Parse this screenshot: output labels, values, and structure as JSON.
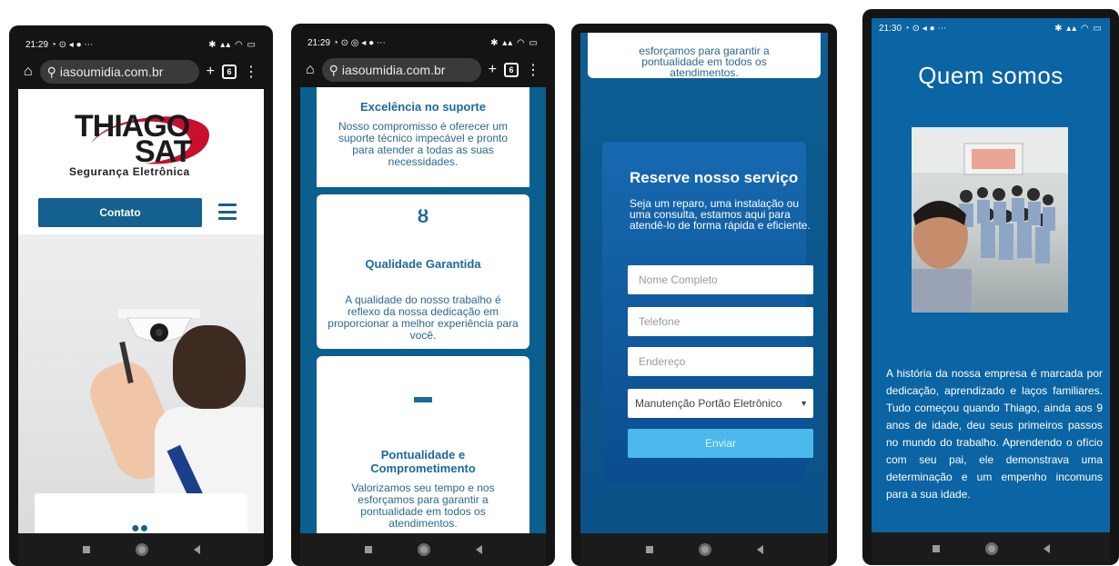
{
  "browser": {
    "url": "iasoumidia.com.br",
    "tab_count": "6"
  },
  "phones": [
    {
      "time": "21:29",
      "logo_line1": "THIAGO",
      "logo_line2": "SAT",
      "logo_sub": "Segurança Eletrônica",
      "contact_button": "Contato"
    },
    {
      "time": "21:29",
      "cards": [
        {
          "title": "Excelência no suporte",
          "text": "Nosso compromisso é oferecer um suporte técnico impecável e pronto para atender a todas as suas necessidades."
        },
        {
          "title": "Qualidade Garantida",
          "text": "A qualidade do nosso trabalho é reflexo da nossa dedicação em proporcionar a melhor experiência para você."
        },
        {
          "title": "Pontualidade e Comprometimento",
          "text": "Valorizamos seu tempo e nos esforçamos para garantir a pontualidade em todos os atendimentos."
        }
      ]
    },
    {
      "time": "21:29",
      "top_card_text": "esforçamos para garantir a pontualidade em todos os atendimentos.",
      "form_title": "Reserve nosso serviço",
      "form_desc": "Seja um reparo, uma instalação ou uma consulta, estamos aqui para atendê-lo de forma rápida e eficiente.",
      "placeholder_name": "Nome Completo",
      "placeholder_phone": "Telefone",
      "placeholder_address": "Endereço",
      "select_value": "Manutenção Portão Eletrônico",
      "submit_label": "Enviar"
    },
    {
      "time": "21:30",
      "title": "Quem somos",
      "paragraph": "A história da nossa empresa é marcada por dedicação, aprendizado e laços familiares. Tudo começou quando Thiago, ainda aos 9 anos de idade, deu seus primeiros passos no mundo do trabalho. Aprendendo o ofício com seu pai, ele demonstrava uma determinação e um empenho incomuns para a sua idade."
    }
  ],
  "colors": {
    "brand_blue": "#14608f",
    "section_blue": "#0a5f8f",
    "button_light": "#4ab8ea"
  },
  "icons": [
    "home-icon",
    "plus-icon",
    "menu-dots-icon",
    "hamburger-icon",
    "people-icon",
    "medal-icon",
    "card-icon",
    "dropdown-caret-icon"
  ]
}
